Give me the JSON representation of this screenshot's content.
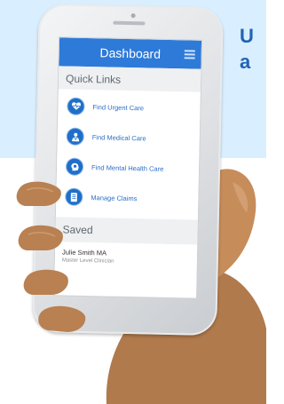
{
  "headline": {
    "line1": "U",
    "line2": "a"
  },
  "app": {
    "title": "Dashboard"
  },
  "quick_links": {
    "heading": "Quick Links",
    "items": [
      {
        "label": "Find Urgent Care",
        "icon": "heart-pulse-icon"
      },
      {
        "label": "Find Medical Care",
        "icon": "doctor-icon"
      },
      {
        "label": "Find Mental Health Care",
        "icon": "head-brain-icon"
      },
      {
        "label": "Manage Claims",
        "icon": "document-icon"
      }
    ]
  },
  "saved": {
    "heading": "Saved",
    "items": [
      {
        "name": "Julie Smith MA",
        "role": "Master Level Clinician"
      }
    ]
  },
  "colors": {
    "header_blue": "#2e7ad8",
    "icon_blue": "#1f6fc9",
    "headline_blue": "#1f63b6",
    "sky": "#d9efff"
  }
}
